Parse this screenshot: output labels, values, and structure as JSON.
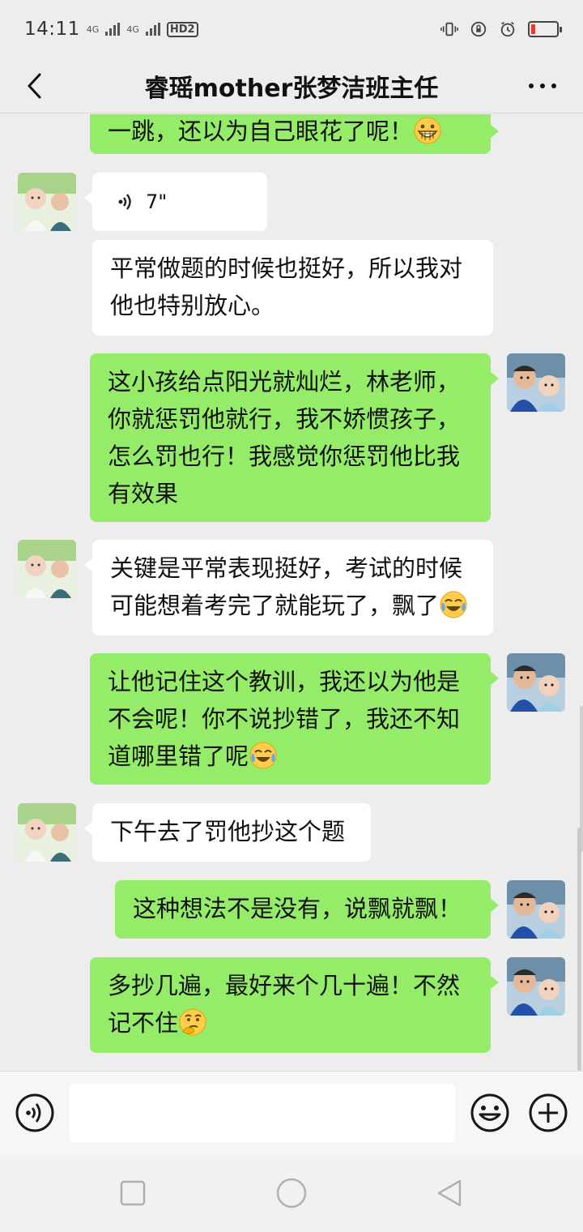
{
  "status_bar": {
    "time": "14:11",
    "network_1": "4G",
    "network_2": "4G",
    "hd": "HD2"
  },
  "header": {
    "title": "睿瑶mother张梦洁班主任"
  },
  "messages": [
    {
      "side": "right",
      "text": "一跳，还以为自己眼花了呢！",
      "emoji": "grin-emoji"
    },
    {
      "side": "left",
      "type": "voice",
      "duration": "7\""
    },
    {
      "side": "left",
      "lines": [
        "平常做题的时候也挺好，所以我对",
        "他也特别放心。"
      ]
    },
    {
      "side": "right",
      "lines": [
        "这小孩给点阳光就灿烂，林老师，",
        "你就惩罚他就行，我不娇惯孩子，",
        "怎么罚也行！我感觉你惩罚他比我",
        "有效果"
      ]
    },
    {
      "side": "left",
      "lines": [
        "关键是平常表现挺好，考试的时候",
        "可能想着考完了就能玩了，飘了"
      ],
      "emoji": "laugh-cry-emoji"
    },
    {
      "side": "right",
      "lines": [
        "让他记住这个教训，我还以为他是",
        "不会呢！你不说抄错了，我还不知",
        "道哪里错了呢"
      ],
      "emoji": "laugh-cry-emoji"
    },
    {
      "side": "left",
      "text": "下午去了罚他抄这个题"
    },
    {
      "side": "right",
      "text": "这种想法不是没有，说飘就飘！"
    },
    {
      "side": "right",
      "lines": [
        "多抄几遍，最好来个几十遍！不然",
        "记不住"
      ],
      "emoji": "thinking-emoji"
    }
  ],
  "input": {
    "value": "",
    "placeholder": ""
  },
  "colors": {
    "sent_bubble": "#95ec69",
    "received_bubble": "#ffffff",
    "background": "#ededed"
  }
}
